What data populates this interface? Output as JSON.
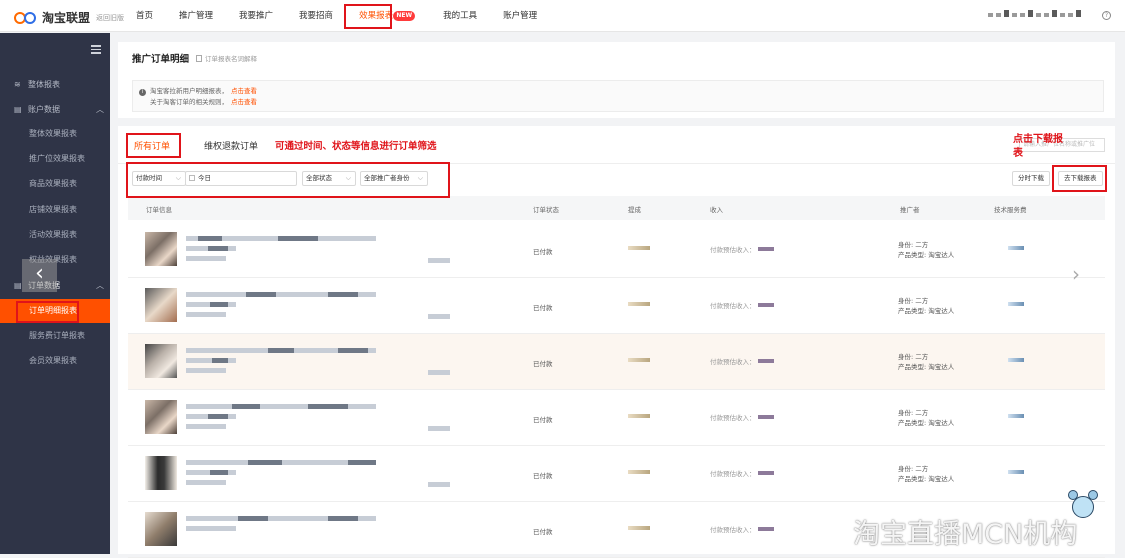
{
  "topbar": {
    "logo_text": "淘宝联盟",
    "logo_sub": "返回旧版",
    "nav": [
      {
        "label": "首页"
      },
      {
        "label": "推广管理"
      },
      {
        "label": "我要推广"
      },
      {
        "label": "我要招商"
      },
      {
        "label": "效果报表",
        "badge": "NEW",
        "active": true
      },
      {
        "label": "我的工具"
      },
      {
        "label": "账户管理"
      }
    ],
    "help_icon": "question-circle-icon"
  },
  "sidebar": {
    "items": [
      {
        "label": "整体报表",
        "icon": "layers-icon"
      },
      {
        "label": "账户数据",
        "icon": "table-icon",
        "expanded": true
      },
      {
        "label": "整体效果报表"
      },
      {
        "label": "推广位效果报表"
      },
      {
        "label": "商品效果报表"
      },
      {
        "label": "店铺效果报表"
      },
      {
        "label": "活动效果报表"
      },
      {
        "label": "权益效果报表"
      },
      {
        "label": "订单数据",
        "icon": "table-icon",
        "expanded": true
      },
      {
        "label": "订单明细报表",
        "active": true
      },
      {
        "label": "服务费订单报表"
      },
      {
        "label": "会员效果报表"
      }
    ]
  },
  "header_card": {
    "title": "推广订单明细",
    "subtitle": "订单报表名词解释",
    "notice_line1": "淘宝客拉新用户明细报表，",
    "notice_line1_link": "点击查看",
    "notice_line2": "关于淘客订单的相关规则，",
    "notice_line2_link": "点击查看"
  },
  "orders_card": {
    "tabs": [
      "所有订单",
      "维权退款订单"
    ],
    "annotation_filter": "可通过时间、状态等信息进行订单筛选",
    "annotation_download": "点击下载报表",
    "search_placeholder": "请输入推广位名称或推广位",
    "filters": {
      "time_type": "付款时间",
      "date": "今日",
      "status": "全部状态",
      "role": "全部推广者身份"
    },
    "buttons": {
      "split_download": "分时下载",
      "download": "去下载报表"
    },
    "columns": [
      "订单信息",
      "订单状态",
      "提成",
      "收入",
      "推广者",
      "技术服务费"
    ],
    "rows": [
      {
        "status": "已付款",
        "income_label": "付款预估收入：",
        "promoter_role": "身份: 二方",
        "promoter_type": "产品类型: 淘宝达人"
      },
      {
        "status": "已付款",
        "income_label": "付款预估收入：",
        "promoter_role": "身份: 二方",
        "promoter_type": "产品类型: 淘宝达人"
      },
      {
        "status": "已付款",
        "income_label": "付款预估收入：",
        "promoter_role": "身份: 二方",
        "promoter_type": "产品类型: 淘宝达人"
      },
      {
        "status": "已付款",
        "income_label": "付款预估收入：",
        "promoter_role": "身份: 二方",
        "promoter_type": "产品类型: 淘宝达人"
      },
      {
        "status": "已付款",
        "income_label": "付款预估收入：",
        "promoter_role": "身份: 二方",
        "promoter_type": "产品类型: 淘宝达人"
      },
      {
        "status": "已付款",
        "income_label": "付款预估收入："
      }
    ]
  },
  "watermark": "淘宝直播MCN机构",
  "colors": {
    "accent": "#ff5000",
    "annotation": "#e0141a",
    "sidebar_bg": "#2f3447"
  }
}
